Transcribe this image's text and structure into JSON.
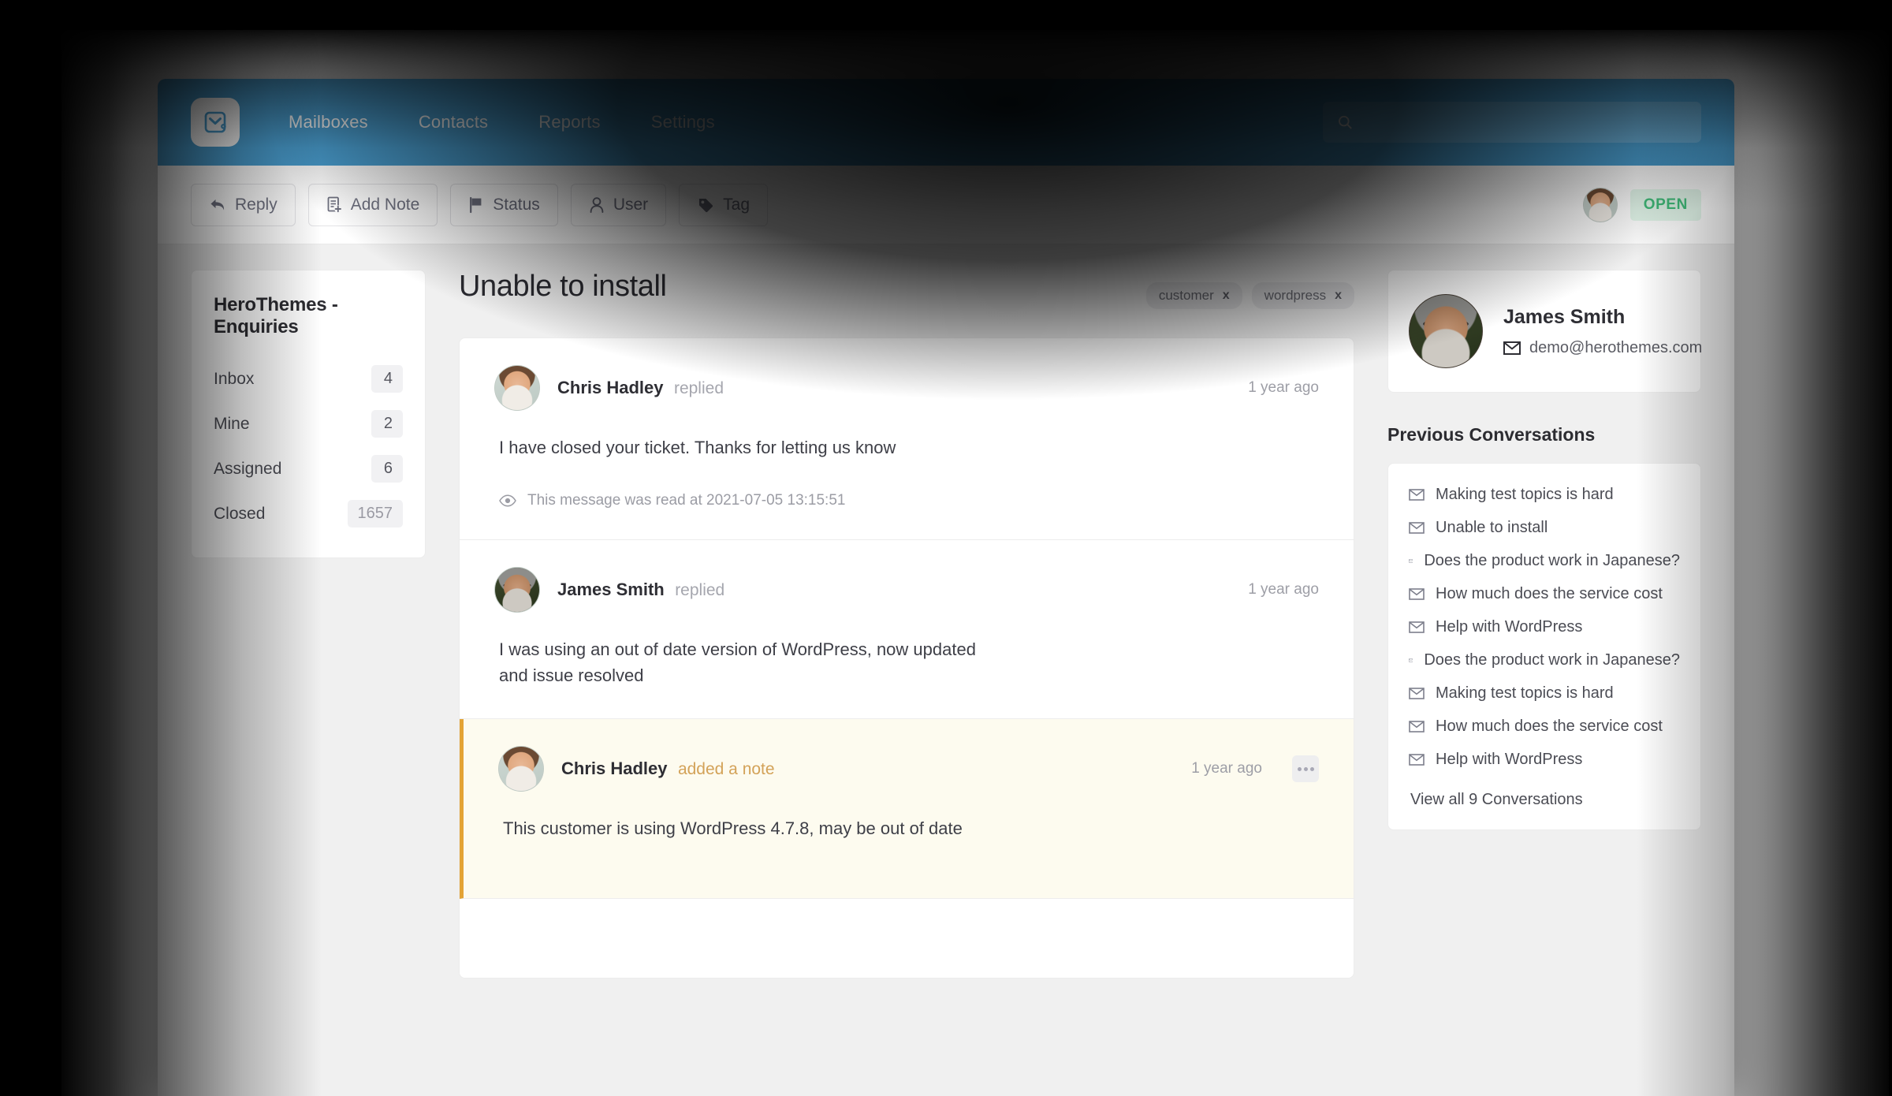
{
  "brand": {
    "accent": "#4a9fd1",
    "logo_icon": "mail-check-icon"
  },
  "topnav": {
    "links": [
      {
        "label": "Mailboxes"
      },
      {
        "label": "Contacts"
      },
      {
        "label": "Reports"
      },
      {
        "label": "Settings"
      }
    ],
    "search": {
      "value": "",
      "placeholder": ""
    }
  },
  "toolbar": {
    "buttons": [
      {
        "label": "Reply",
        "icon": "reply-arrow-icon"
      },
      {
        "label": "Add Note",
        "icon": "note-plus-icon"
      },
      {
        "label": "Status",
        "icon": "flag-icon"
      },
      {
        "label": "User",
        "icon": "user-icon"
      },
      {
        "label": "Tag",
        "icon": "tag-icon"
      }
    ],
    "status_badge": {
      "label": "OPEN",
      "color": "#42c07c",
      "background": "#e4f8ec"
    },
    "assignee_avatar": "chris-hadley-avatar"
  },
  "mailbox": {
    "title": "HeroThemes - Enquiries",
    "folders": [
      {
        "label": "Inbox",
        "count": "4",
        "muted": false
      },
      {
        "label": "Mine",
        "count": "2",
        "muted": false
      },
      {
        "label": "Assigned",
        "count": "6",
        "muted": false
      },
      {
        "label": "Closed",
        "count": "1657",
        "muted": true
      }
    ]
  },
  "conversation": {
    "title": "Unable to install",
    "tags": [
      {
        "label": "customer",
        "remove": "x"
      },
      {
        "label": "wordpress",
        "remove": "x"
      }
    ],
    "messages": [
      {
        "author": "Chris Hadley",
        "action": "replied",
        "time": "1 year ago",
        "body": "I have closed your ticket. Thanks for letting us know",
        "meta": "This message was read at 2021-07-05 13:15:51",
        "meta_icon": "eye-icon",
        "is_note": false,
        "has_more_menu": false,
        "avatar": "chris-hadley-avatar"
      },
      {
        "author": "James Smith",
        "action": "replied",
        "time": "1 year ago",
        "body": "I was using an out of date version of WordPress, now updated and issue resolved",
        "meta": "",
        "meta_icon": "",
        "is_note": false,
        "has_more_menu": false,
        "avatar": "james-smith-avatar"
      },
      {
        "author": "Chris Hadley",
        "action": "added a note",
        "time": "1 year ago",
        "body": "This customer is using WordPress 4.7.8, may be out of date",
        "meta": "",
        "meta_icon": "",
        "is_note": true,
        "has_more_menu": true,
        "avatar": "chris-hadley-avatar"
      }
    ]
  },
  "customer": {
    "name": "James Smith",
    "email": "demo@herothemes.com",
    "email_icon": "envelope-icon",
    "avatar": "james-smith-avatar"
  },
  "previous_conversations": {
    "heading": "Previous Conversations",
    "items": [
      {
        "label": "Making test topics is hard"
      },
      {
        "label": "Unable to install"
      },
      {
        "label": "Does the product work in Japanese?"
      },
      {
        "label": "How much does the service cost"
      },
      {
        "label": "Help with WordPress"
      },
      {
        "label": "Does the product work in Japanese?"
      },
      {
        "label": "Making test topics is hard"
      },
      {
        "label": "How much does the service cost"
      },
      {
        "label": "Help with WordPress"
      }
    ],
    "view_all": "View all 9 Conversations"
  }
}
